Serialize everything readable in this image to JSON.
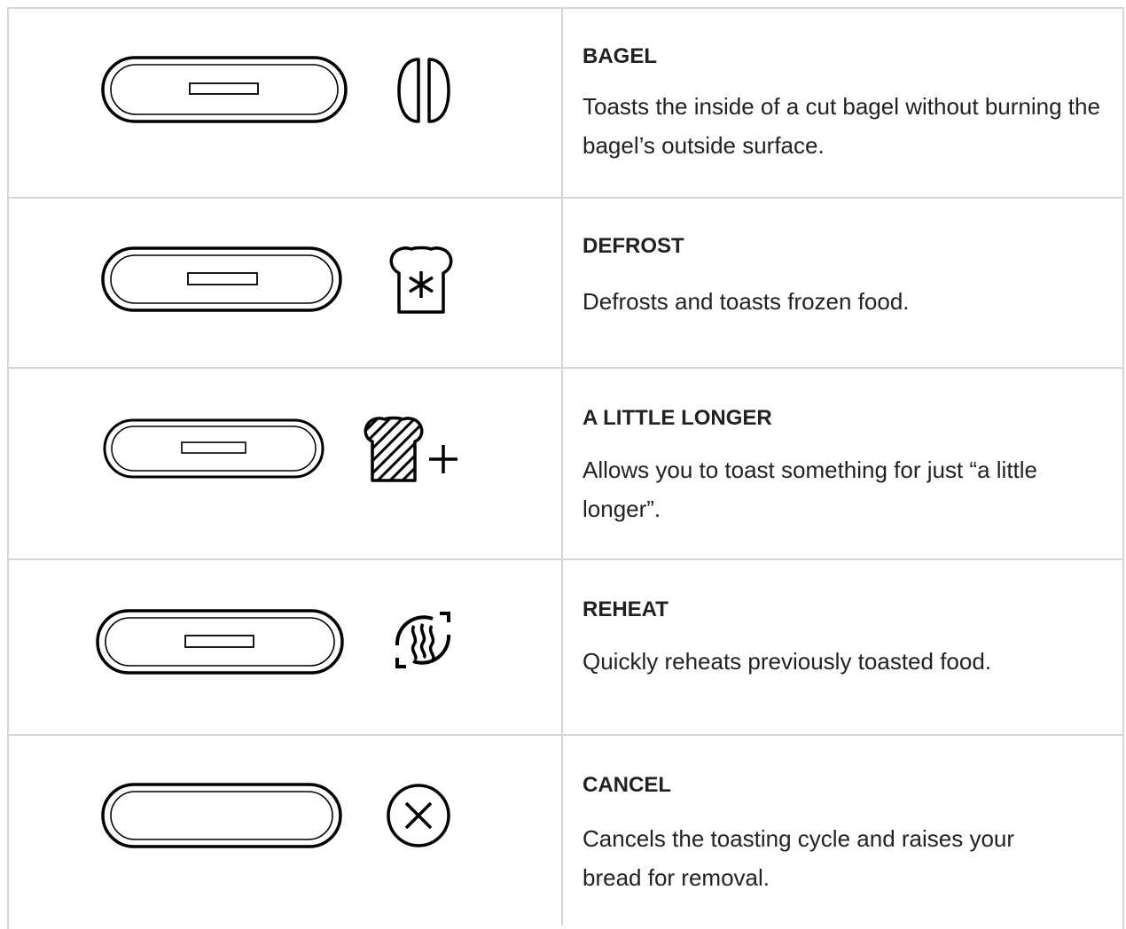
{
  "rows": [
    {
      "title": "BAGEL",
      "description": "Toasts the inside of a cut bagel without burning the bagel’s outside surface.",
      "icon": "bagel-icon"
    },
    {
      "title": "DEFROST",
      "description": "Defrosts and toasts frozen food.",
      "icon": "defrost-icon"
    },
    {
      "title": "A LITTLE LONGER",
      "description": "Allows you to toast something for just “a little longer”.",
      "icon": "a-little-longer-icon"
    },
    {
      "title": "REHEAT",
      "description": "Quickly reheats previously toasted food.",
      "icon": "reheat-icon"
    },
    {
      "title": "CANCEL",
      "description": "Cancels the toasting cycle and raises your bread for removal.",
      "icon": "cancel-icon"
    }
  ]
}
